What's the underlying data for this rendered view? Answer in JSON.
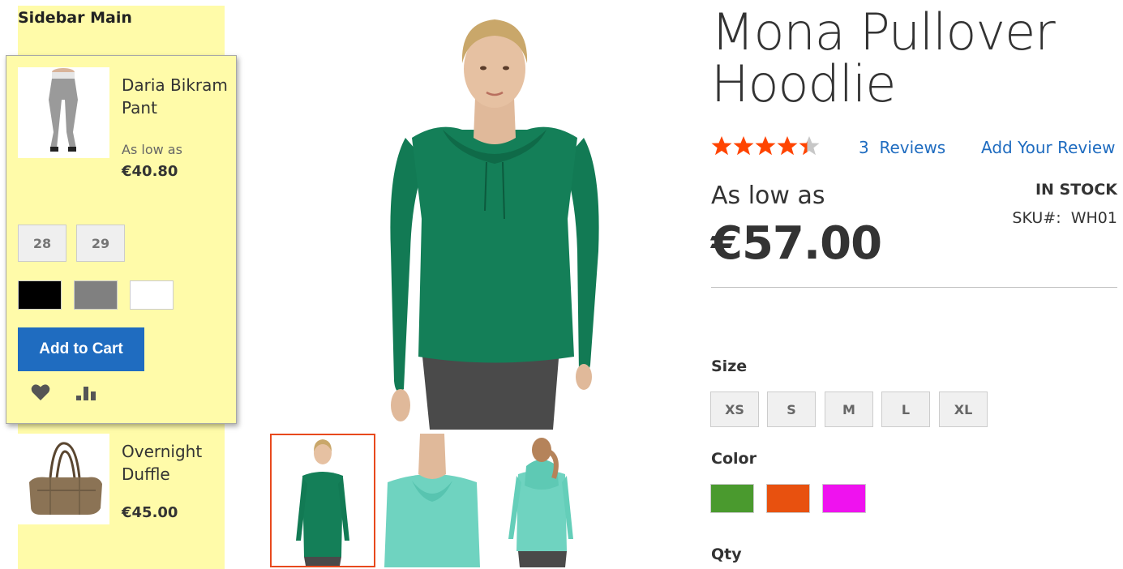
{
  "sidebar": {
    "title": "Sidebar Main",
    "popup_product": {
      "name": "Daria Bikram Pant",
      "as_low_as": "As low as",
      "price": "€40.80",
      "sizes": [
        "28",
        "29"
      ],
      "colors": [
        "#000000",
        "#808080",
        "#ffffff"
      ],
      "add_to_cart": "Add to Cart",
      "wishlist_icon": "heart-icon",
      "compare_icon": "bar-chart-icon"
    },
    "second_product": {
      "name": "Overnight Duffle",
      "price": "€45.00"
    }
  },
  "product": {
    "title_line1": "Mona Pullover",
    "title_line2": "Hoodlie",
    "rating_fraction": 0.87,
    "reviews_count": "3",
    "reviews_label": "Reviews",
    "add_review": "Add Your Review",
    "as_low_as": "As low as",
    "price": "€57.00",
    "stock": "IN STOCK",
    "sku_label": "SKU#:",
    "sku_value": "WH01",
    "size_label": "Size",
    "sizes": [
      "XS",
      "S",
      "M",
      "L",
      "XL"
    ],
    "color_label": "Color",
    "colors": [
      "#4a9a2e",
      "#e8510f",
      "#ef12ef"
    ],
    "qty_label": "Qty"
  },
  "theme": {
    "sidebar_bg": "#fffba9",
    "accent": "#1f6cc0",
    "star": "#ff4400",
    "thumb_active_border": "#e8491d"
  }
}
